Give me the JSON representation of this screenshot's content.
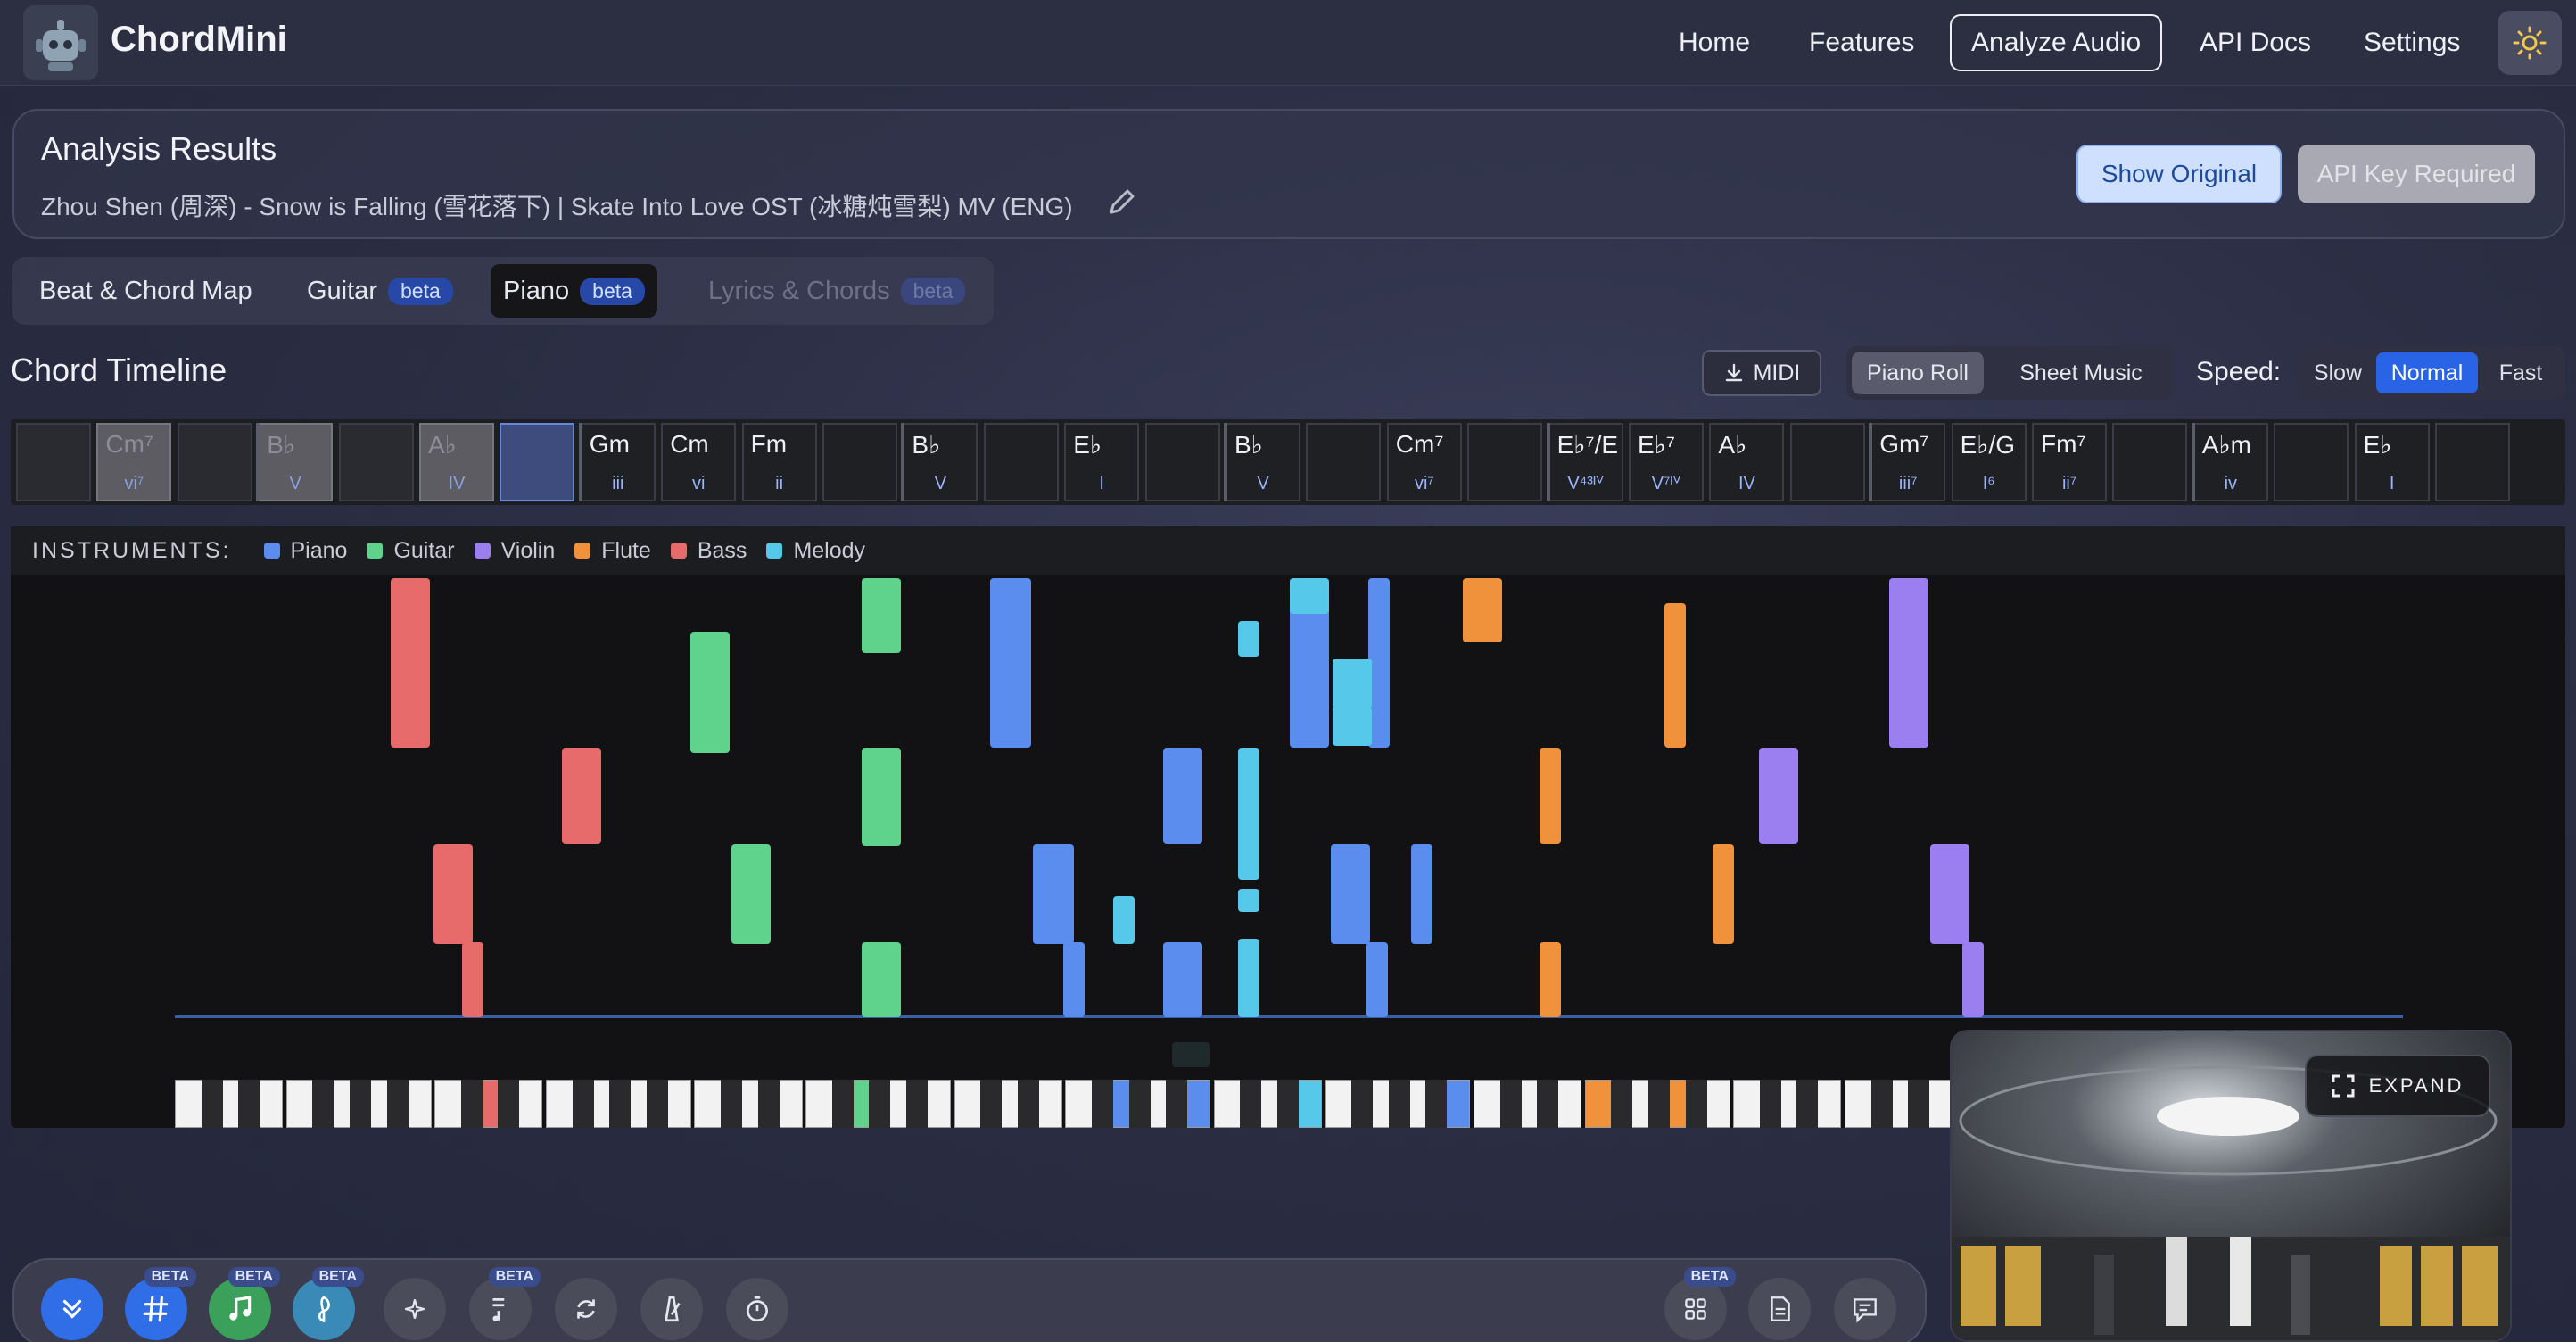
{
  "nav": {
    "brand": "ChordMini",
    "links": [
      "Home",
      "Features",
      "Analyze Audio",
      "API Docs",
      "Settings"
    ],
    "active": "Analyze Audio"
  },
  "analysis": {
    "title": "Analysis Results",
    "subtitle": "Zhou Shen (周深) - Snow is Falling (雪花落下) | Skate Into Love OST (冰糖炖雪梨) MV (ENG)",
    "show_original": "Show Original",
    "api_key": "API Key Required"
  },
  "tabs": [
    {
      "label": "Beat & Chord Map",
      "beta": ""
    },
    {
      "label": "Guitar",
      "beta": "beta"
    },
    {
      "label": "Piano",
      "beta": "beta"
    },
    {
      "label": "Lyrics & Chords",
      "beta": "beta"
    }
  ],
  "timeline": {
    "title": "Chord Timeline",
    "midi": "MIDI",
    "views": [
      "Piano Roll",
      "Sheet Music"
    ],
    "speed_label": "Speed:",
    "speeds": [
      "Slow",
      "Normal",
      "Fast"
    ],
    "chords": [
      {
        "name": "",
        "roman": ""
      },
      {
        "name": "Cm⁷",
        "roman": "vi⁷"
      },
      {
        "name": "",
        "roman": ""
      },
      {
        "name": "B♭",
        "roman": "V"
      },
      {
        "name": "",
        "roman": ""
      },
      {
        "name": "A♭",
        "roman": "IV"
      },
      {
        "name": "",
        "roman": ""
      },
      {
        "name": "Gm",
        "roman": "iii"
      },
      {
        "name": "Cm",
        "roman": "vi"
      },
      {
        "name": "Fm",
        "roman": "ii"
      },
      {
        "name": "",
        "roman": ""
      },
      {
        "name": "B♭",
        "roman": "V"
      },
      {
        "name": "",
        "roman": ""
      },
      {
        "name": "E♭",
        "roman": "I"
      },
      {
        "name": "",
        "roman": ""
      },
      {
        "name": "B♭",
        "roman": "V"
      },
      {
        "name": "",
        "roman": ""
      },
      {
        "name": "Cm⁷",
        "roman": "vi⁷"
      },
      {
        "name": "",
        "roman": ""
      },
      {
        "name": "E♭⁷/E",
        "roman": "V⁴³ᴵⱽ"
      },
      {
        "name": "E♭⁷",
        "roman": "V⁷ᴵⱽ"
      },
      {
        "name": "A♭",
        "roman": "IV"
      },
      {
        "name": "",
        "roman": ""
      },
      {
        "name": "Gm⁷",
        "roman": "iii⁷"
      },
      {
        "name": "E♭/G",
        "roman": "I⁶"
      },
      {
        "name": "Fm⁷",
        "roman": "ii⁷"
      },
      {
        "name": "",
        "roman": ""
      },
      {
        "name": "A♭m",
        "roman": "iv"
      },
      {
        "name": "",
        "roman": ""
      },
      {
        "name": "E♭",
        "roman": "I"
      },
      {
        "name": "",
        "roman": ""
      }
    ]
  },
  "instruments": {
    "label": "INSTRUMENTS:",
    "items": [
      {
        "name": "Piano",
        "color": "#5b8def"
      },
      {
        "name": "Guitar",
        "color": "#5fd38c"
      },
      {
        "name": "Violin",
        "color": "#9b7ff0"
      },
      {
        "name": "Flute",
        "color": "#f0913c"
      },
      {
        "name": "Bass",
        "color": "#e86b6b"
      },
      {
        "name": "Melody",
        "color": "#56c8ea"
      }
    ]
  },
  "video": {
    "expand": "EXPAND"
  },
  "toolbar": {
    "tools": [
      {
        "icon": "chevrons-down-icon",
        "badge": ""
      },
      {
        "icon": "hash-icon",
        "badge": "BETA"
      },
      {
        "icon": "music-note-icon",
        "badge": "BETA"
      },
      {
        "icon": "treble-clef-icon",
        "badge": "BETA"
      },
      {
        "icon": "sparkles-icon",
        "badge": ""
      },
      {
        "icon": "music-list-icon",
        "badge": "BETA"
      },
      {
        "icon": "refresh-icon",
        "badge": ""
      },
      {
        "icon": "metronome-icon",
        "badge": ""
      },
      {
        "icon": "stopwatch-icon",
        "badge": ""
      },
      {
        "icon": "grid-icon",
        "badge": "BETA"
      },
      {
        "icon": "document-icon",
        "badge": ""
      },
      {
        "icon": "chat-icon",
        "badge": ""
      }
    ]
  }
}
